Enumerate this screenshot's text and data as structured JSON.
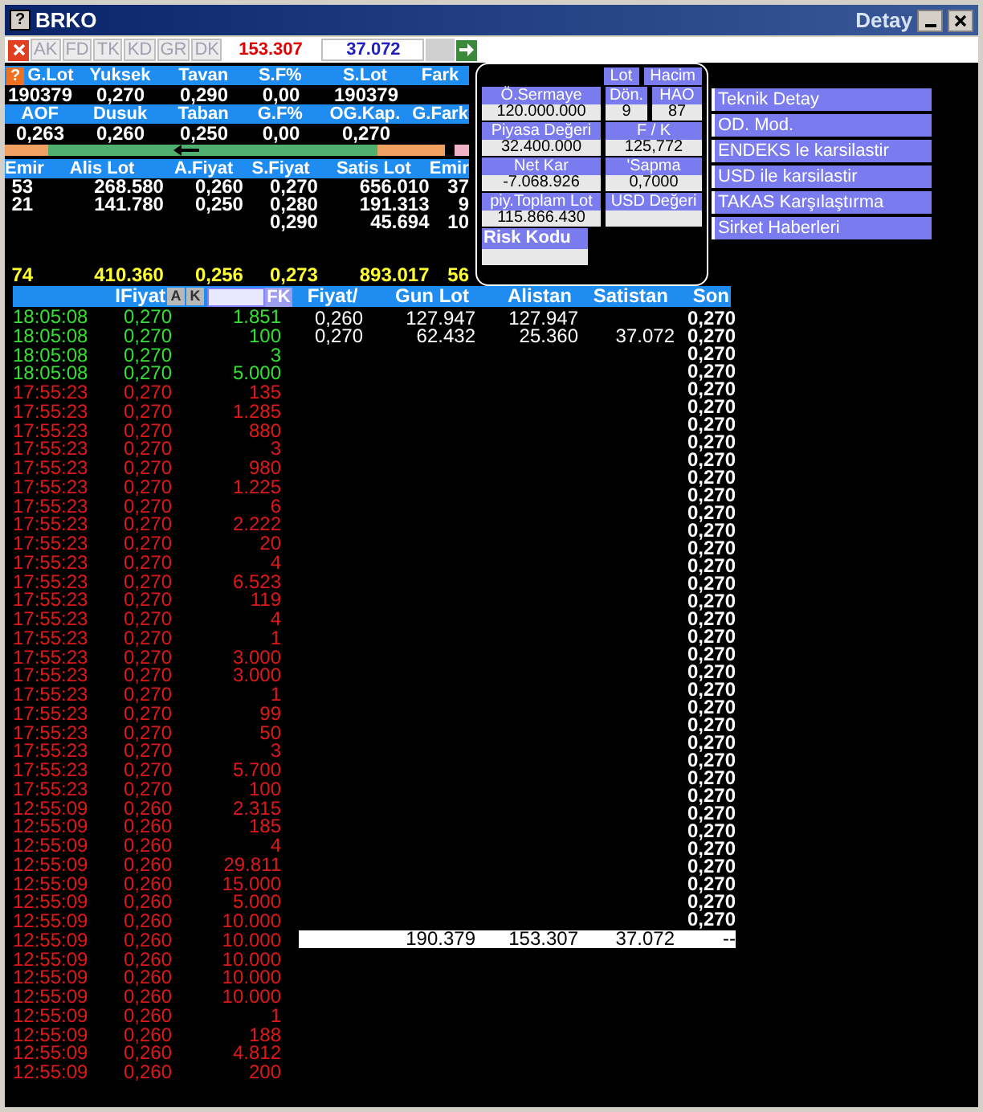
{
  "window": {
    "title": "BRKO",
    "detail_title": "Detay",
    "help_glyph": "?"
  },
  "toolbar": {
    "tabs": [
      {
        "label": "AK",
        "disabled": true
      },
      {
        "label": "FD",
        "disabled": true
      },
      {
        "label": "TK",
        "disabled": true
      },
      {
        "label": "KD",
        "disabled": true
      },
      {
        "label": "GR",
        "disabled": true
      },
      {
        "label": "DK",
        "disabled": true
      }
    ],
    "sell_total": "153.307",
    "buy_total": "37.072"
  },
  "summary": {
    "help_glyph": "?",
    "rows": [
      {
        "headers": [
          "G.Lot",
          "Yuksek",
          "Tavan",
          "S.F%",
          "S.Lot",
          "Fark"
        ],
        "values": [
          "190379",
          "0,270",
          "0,290",
          "0,00",
          "190379"
        ]
      },
      {
        "headers": [
          "AOF",
          "Dusuk",
          "Taban",
          "G.F%",
          "OG.Kap.",
          "G.Fark"
        ],
        "values": [
          "0,263",
          "0,260",
          "0,250",
          "0,00",
          "0,270"
        ]
      }
    ]
  },
  "depth": {
    "columns": [
      "Emir",
      "Alis Lot",
      "A.Fiyat",
      "S.Fiyat",
      "Satis Lot",
      "Emir"
    ],
    "rows": [
      [
        "53",
        "268.580",
        "0,260",
        "0,270",
        "656.010",
        "37"
      ],
      [
        "21",
        "141.780",
        "0,250",
        "0,280",
        "191.313",
        "9"
      ],
      [
        "",
        "",
        "",
        "0,290",
        "45.694",
        "10"
      ]
    ],
    "totals": [
      "74",
      "410.360",
      "0,256",
      "0,273",
      "893.017",
      "56"
    ]
  },
  "detail": {
    "buttons": [
      "Lot",
      "Hacim"
    ],
    "fields": [
      {
        "label": "Ö.Sermaye",
        "value": "120.000.000"
      },
      {
        "label": "Dön.",
        "value": "9"
      },
      {
        "label": "HAO",
        "value": "87"
      },
      {
        "label": "Piyasa Değeri",
        "value": "32.400.000"
      },
      {
        "label": "F / K",
        "value": "125,772"
      },
      {
        "label": "Net Kar",
        "value": "-7.068.926"
      },
      {
        "label": "'Sapma",
        "value": "0,7000"
      },
      {
        "label": "piy.Toplam Lot",
        "value": "115.866.430"
      },
      {
        "label": "USD Değeri"
      }
    ],
    "risk_label": "Risk Kodu"
  },
  "menu": [
    "Teknik Detay",
    "OD. Mod.",
    "ENDEKS le karsilastir",
    "USD ile karsilastir",
    "TAKAS Karşılaştırma",
    "Sirket Haberleri"
  ],
  "trades_header": {
    "price": "IFiyat",
    "buttons": [
      "A",
      "K"
    ],
    "fk": "FK"
  },
  "trades": [
    {
      "time": "18:05:08",
      "price": "0,270",
      "lot": "1.851",
      "kind": "up"
    },
    {
      "time": "18:05:08",
      "price": "0,270",
      "lot": "100",
      "kind": "up"
    },
    {
      "time": "18:05:08",
      "price": "0,270",
      "lot": "3",
      "kind": "up"
    },
    {
      "time": "18:05:08",
      "price": "0,270",
      "lot": "5.000",
      "kind": "up"
    },
    {
      "time": "17:55:23",
      "price": "0,270",
      "lot": "135",
      "kind": "down"
    },
    {
      "time": "17:55:23",
      "price": "0,270",
      "lot": "1.285",
      "kind": "down"
    },
    {
      "time": "17:55:23",
      "price": "0,270",
      "lot": "880",
      "kind": "down"
    },
    {
      "time": "17:55:23",
      "price": "0,270",
      "lot": "3",
      "kind": "down"
    },
    {
      "time": "17:55:23",
      "price": "0,270",
      "lot": "980",
      "kind": "down"
    },
    {
      "time": "17:55:23",
      "price": "0,270",
      "lot": "1.225",
      "kind": "down"
    },
    {
      "time": "17:55:23",
      "price": "0,270",
      "lot": "6",
      "kind": "down"
    },
    {
      "time": "17:55:23",
      "price": "0,270",
      "lot": "2.222",
      "kind": "down"
    },
    {
      "time": "17:55:23",
      "price": "0,270",
      "lot": "20",
      "kind": "down"
    },
    {
      "time": "17:55:23",
      "price": "0,270",
      "lot": "4",
      "kind": "down"
    },
    {
      "time": "17:55:23",
      "price": "0,270",
      "lot": "6.523",
      "kind": "down"
    },
    {
      "time": "17:55:23",
      "price": "0,270",
      "lot": "119",
      "kind": "down"
    },
    {
      "time": "17:55:23",
      "price": "0,270",
      "lot": "4",
      "kind": "down"
    },
    {
      "time": "17:55:23",
      "price": "0,270",
      "lot": "1",
      "kind": "down"
    },
    {
      "time": "17:55:23",
      "price": "0,270",
      "lot": "3.000",
      "kind": "down"
    },
    {
      "time": "17:55:23",
      "price": "0,270",
      "lot": "3.000",
      "kind": "down"
    },
    {
      "time": "17:55:23",
      "price": "0,270",
      "lot": "1",
      "kind": "down"
    },
    {
      "time": "17:55:23",
      "price": "0,270",
      "lot": "99",
      "kind": "down"
    },
    {
      "time": "17:55:23",
      "price": "0,270",
      "lot": "50",
      "kind": "down"
    },
    {
      "time": "17:55:23",
      "price": "0,270",
      "lot": "3",
      "kind": "down"
    },
    {
      "time": "17:55:23",
      "price": "0,270",
      "lot": "5.700",
      "kind": "down"
    },
    {
      "time": "17:55:23",
      "price": "0,270",
      "lot": "100",
      "kind": "down"
    },
    {
      "time": "12:55:09",
      "price": "0,260",
      "lot": "2.315",
      "kind": "down"
    },
    {
      "time": "12:55:09",
      "price": "0,260",
      "lot": "185",
      "kind": "down"
    },
    {
      "time": "12:55:09",
      "price": "0,260",
      "lot": "4",
      "kind": "down"
    },
    {
      "time": "12:55:09",
      "price": "0,260",
      "lot": "29.811",
      "kind": "down"
    },
    {
      "time": "12:55:09",
      "price": "0,260",
      "lot": "15.000",
      "kind": "down"
    },
    {
      "time": "12:55:09",
      "price": "0,260",
      "lot": "5.000",
      "kind": "down"
    },
    {
      "time": "12:55:09",
      "price": "0,260",
      "lot": "10.000",
      "kind": "down"
    },
    {
      "time": "12:55:09",
      "price": "0,260",
      "lot": "10.000",
      "kind": "down"
    },
    {
      "time": "12:55:09",
      "price": "0,260",
      "lot": "10.000",
      "kind": "down"
    },
    {
      "time": "12:55:09",
      "price": "0,260",
      "lot": "10.000",
      "kind": "down"
    },
    {
      "time": "12:55:09",
      "price": "0,260",
      "lot": "10.000",
      "kind": "down"
    },
    {
      "time": "12:55:09",
      "price": "0,260",
      "lot": "1",
      "kind": "down"
    },
    {
      "time": "12:55:09",
      "price": "0,260",
      "lot": "188",
      "kind": "down"
    },
    {
      "time": "12:55:09",
      "price": "0,260",
      "lot": "4.812",
      "kind": "down"
    },
    {
      "time": "12:55:09",
      "price": "0,260",
      "lot": "200",
      "kind": "down"
    }
  ],
  "price_table": {
    "columns": [
      "Fiyat/",
      "Gun Lot",
      "Alistan",
      "Satistan",
      "Son"
    ],
    "rows": [
      [
        "0,260",
        "127.947",
        "127.947",
        ""
      ],
      [
        "0,270",
        "62.432",
        "25.360",
        "37.072"
      ]
    ],
    "son": [
      "0,270",
      "0,270",
      "0,270",
      "0,270",
      "0,270",
      "0,270",
      "0,270",
      "0,270",
      "0,270",
      "0,270",
      "0,270",
      "0,270",
      "0,270",
      "0,270",
      "0,270",
      "0,270",
      "0,270",
      "0,270",
      "0,270",
      "0,270",
      "0,270",
      "0,270",
      "0,270",
      "0,270",
      "0,270",
      "0,270",
      "0,270",
      "0,270",
      "0,270",
      "0,270",
      "0,270",
      "0,270",
      "0,270",
      "0,270",
      "0,270"
    ],
    "totals": [
      "190.379",
      "153.307",
      "37.072",
      "--"
    ]
  }
}
